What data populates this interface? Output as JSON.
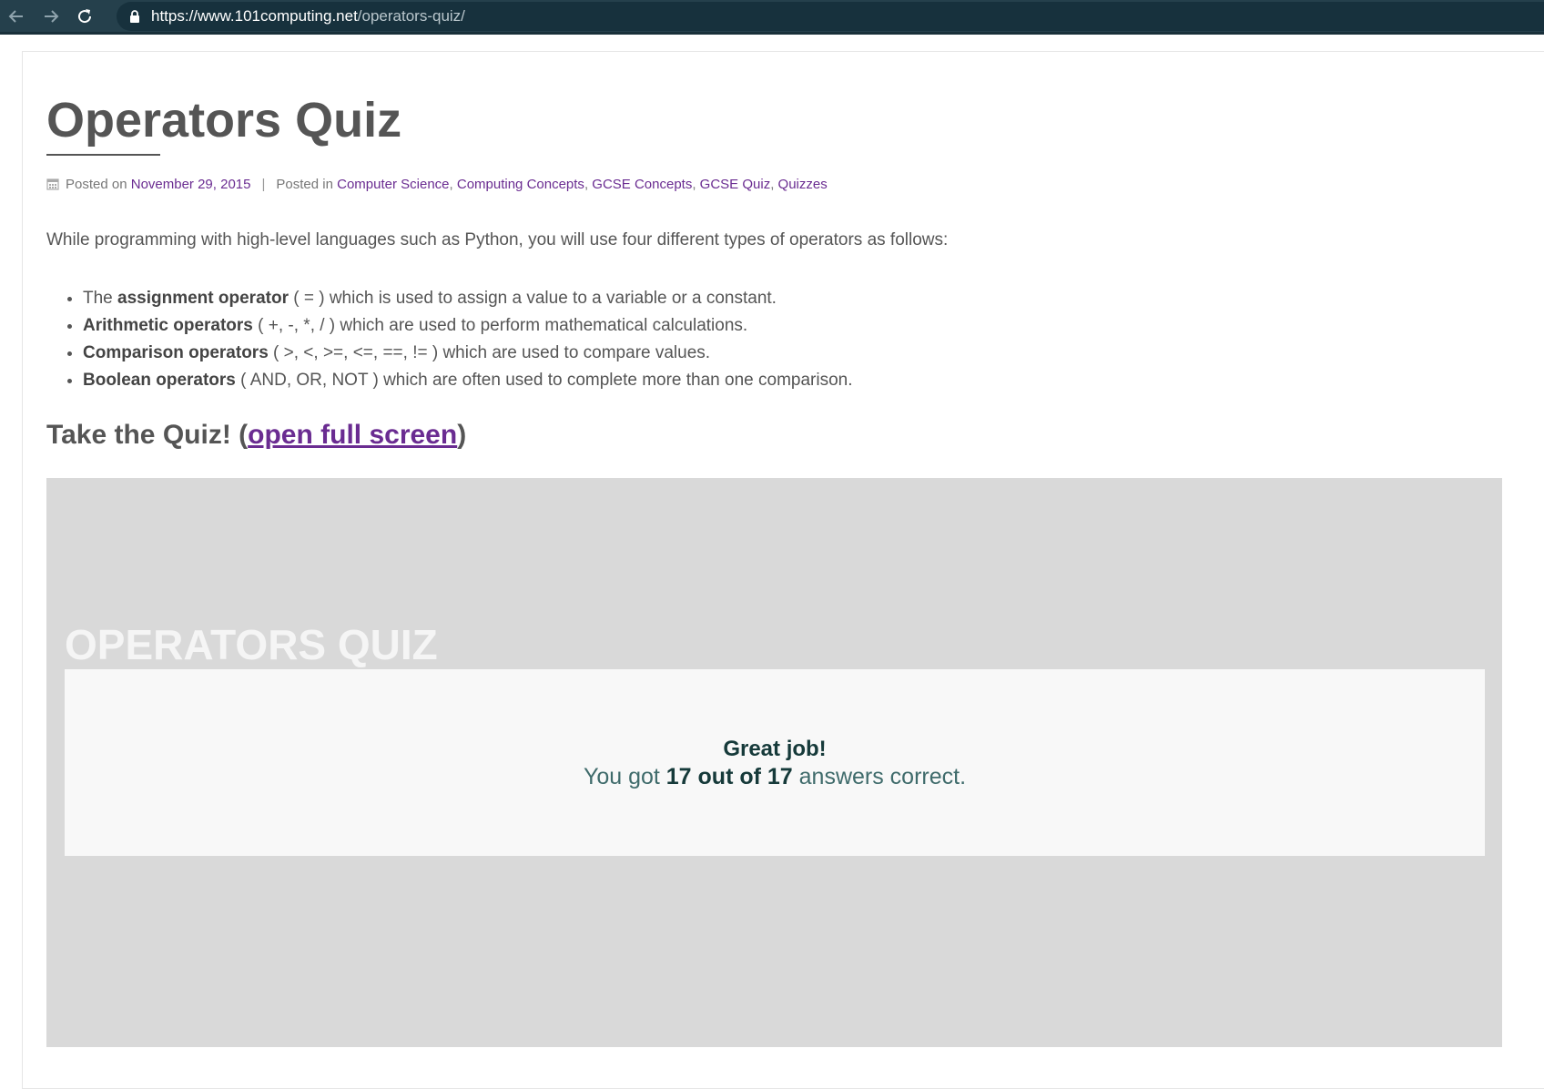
{
  "browser": {
    "url_host": "https://www.101computing.net",
    "url_path": "/operators-quiz/"
  },
  "article": {
    "title": "Operators Quiz",
    "meta": {
      "posted_on_label": "Posted on",
      "date": "November 29, 2015",
      "separator": "|",
      "posted_in_label": "Posted in",
      "categories": [
        "Computer Science",
        "Computing Concepts",
        "GCSE Concepts",
        "GCSE Quiz",
        "Quizzes"
      ]
    },
    "intro": "While programming with high-level languages such as Python, you will use four different types of operators as follows:",
    "bullets": [
      {
        "prefix": "The ",
        "term": "assignment operator",
        "rest": " ( = ) which is used to assign a value to a variable or a constant."
      },
      {
        "prefix": "",
        "term": "Arithmetic operators",
        "rest": " ( +, -, *, / ) which are used to perform mathematical calculations."
      },
      {
        "prefix": "",
        "term": "Comparison operators",
        "rest": " ( >, <, >=, <=, ==, != ) which are used to compare values."
      },
      {
        "prefix": "",
        "term": "Boolean operators",
        "rest": " ( AND, OR, NOT ) which are often used to complete more than one comparison."
      }
    ],
    "quiz_heading_prefix": "Take the Quiz! (",
    "quiz_heading_link": "open full screen",
    "quiz_heading_suffix": ")"
  },
  "quiz": {
    "title": "OPERATORS QUIZ",
    "result_heading": "Great job!",
    "result_prefix": "You got ",
    "result_score": "17 out of 17",
    "result_suffix": " answers correct."
  },
  "colors": {
    "chrome_bg": "#25404c",
    "link": "#6a2c91",
    "quiz_bg": "#d9d9d9",
    "result_text": "#163a3a"
  },
  "icons": [
    "back-arrow-icon",
    "forward-arrow-icon",
    "reload-icon",
    "lock-icon",
    "calendar-icon"
  ]
}
